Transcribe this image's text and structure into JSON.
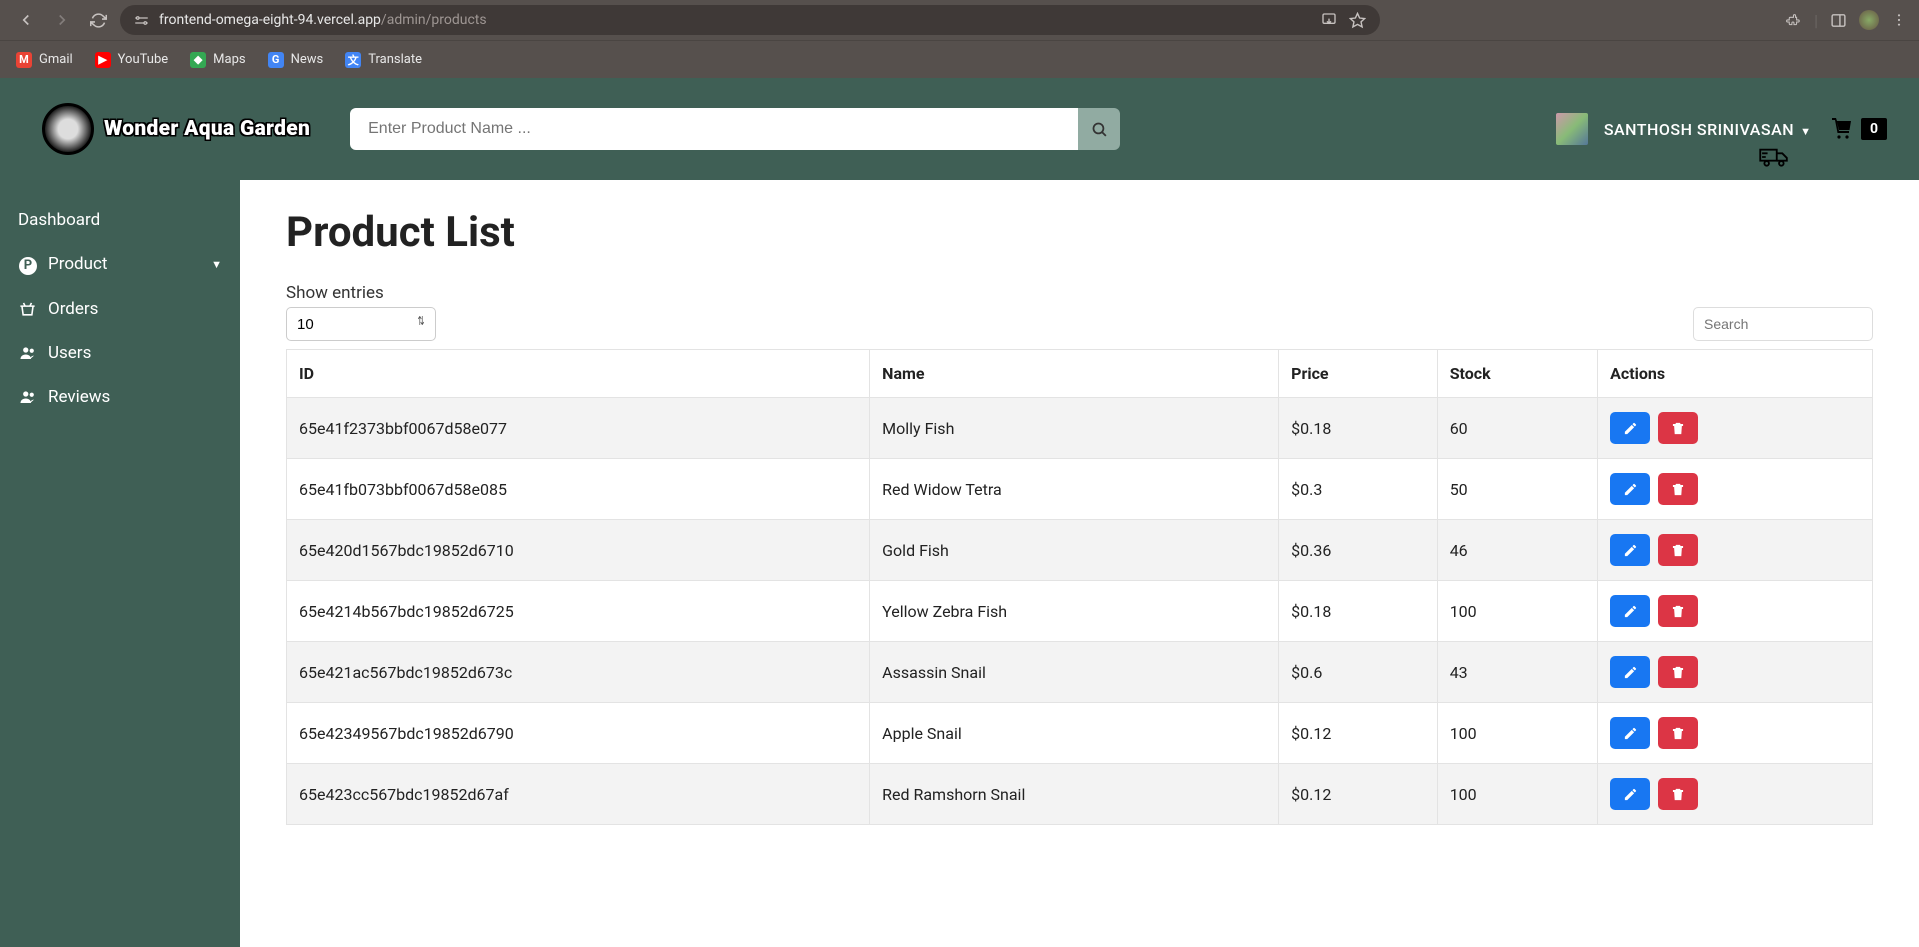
{
  "browser": {
    "url_host": "frontend-omega-eight-94.vercel.app",
    "url_path": "/admin/products",
    "bookmarks": [
      {
        "label": "Gmail",
        "color": "#ea4335",
        "text": "M"
      },
      {
        "label": "YouTube",
        "color": "#ff0000",
        "text": "▶"
      },
      {
        "label": "Maps",
        "color": "#34a853",
        "text": "◆"
      },
      {
        "label": "News",
        "color": "#4285f4",
        "text": "G"
      },
      {
        "label": "Translate",
        "color": "#4285f4",
        "text": "文"
      }
    ]
  },
  "header": {
    "brand": "Wonder Aqua Garden",
    "search_placeholder": "Enter Product Name ...",
    "user_name": "SANTHOSH SRINIVASAN",
    "cart_count": "0"
  },
  "sidebar": {
    "items": [
      {
        "label": "Dashboard",
        "icon": ""
      },
      {
        "label": "Product",
        "icon": "P",
        "expandable": true,
        "active": true
      },
      {
        "label": "Orders",
        "icon": "basket"
      },
      {
        "label": "Users",
        "icon": "users"
      },
      {
        "label": "Reviews",
        "icon": "users"
      }
    ]
  },
  "page": {
    "title": "Product List",
    "entries_label": "Show entries",
    "entries_value": "10",
    "table_search_placeholder": "Search",
    "columns": [
      "ID",
      "Name",
      "Price",
      "Stock",
      "Actions"
    ],
    "rows": [
      {
        "id": "65e41f2373bbf0067d58e077",
        "name": "Molly Fish",
        "price": "$0.18",
        "stock": "60"
      },
      {
        "id": "65e41fb073bbf0067d58e085",
        "name": "Red Widow Tetra",
        "price": "$0.3",
        "stock": "50"
      },
      {
        "id": "65e420d1567bdc19852d6710",
        "name": "Gold Fish",
        "price": "$0.36",
        "stock": "46"
      },
      {
        "id": "65e4214b567bdc19852d6725",
        "name": "Yellow Zebra Fish",
        "price": "$0.18",
        "stock": "100"
      },
      {
        "id": "65e421ac567bdc19852d673c",
        "name": "Assassin Snail",
        "price": "$0.6",
        "stock": "43"
      },
      {
        "id": "65e42349567bdc19852d6790",
        "name": "Apple Snail",
        "price": "$0.12",
        "stock": "100"
      },
      {
        "id": "65e423cc567bdc19852d67af",
        "name": "Red Ramshorn Snail",
        "price": "$0.12",
        "stock": "100"
      }
    ]
  }
}
